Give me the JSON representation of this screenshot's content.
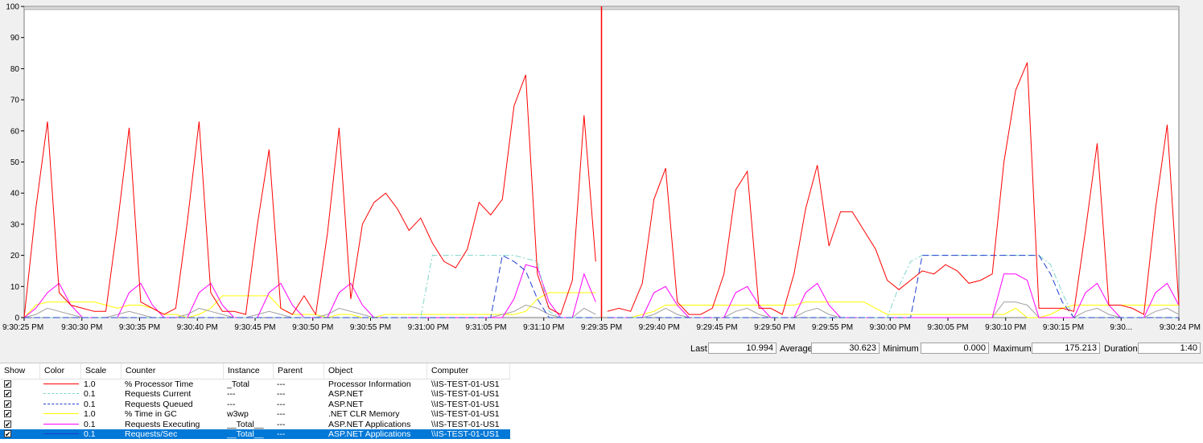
{
  "chart_data": {
    "type": "line",
    "ylim": [
      0,
      100
    ],
    "yticks": [
      0,
      10,
      20,
      30,
      40,
      50,
      60,
      70,
      80,
      90,
      100
    ],
    "xticks": [
      "9:30:25 PM",
      "9:30:30 PM",
      "9:30:35 PM",
      "9:30:40 PM",
      "9:30:45 PM",
      "9:30:50 PM",
      "9:30:55 PM",
      "9:31:00 PM",
      "9:31:05 PM",
      "9:31:10 PM",
      "9:29:35 PM",
      "9:29:40 PM",
      "9:29:45 PM",
      "9:29:50 PM",
      "9:29:55 PM",
      "9:30:00 PM",
      "9:30:05 PM",
      "9:30:10 PM",
      "9:30:15 PM",
      "9:30...",
      "9:30:24 PM"
    ],
    "samples": 100,
    "current_index": 49,
    "series": [
      {
        "name": "% Processor Time",
        "color": "#ff0000",
        "dash": "solid",
        "values": [
          0,
          35,
          63,
          8,
          4,
          3,
          2,
          2,
          30,
          61,
          5,
          3,
          1,
          3,
          31,
          63,
          8,
          2,
          2,
          1,
          30,
          54,
          3,
          1,
          7,
          1,
          27,
          61,
          6,
          30,
          37,
          40,
          35,
          28,
          32,
          24,
          18,
          16,
          22,
          37,
          33,
          38,
          68,
          78,
          14,
          3,
          1,
          12,
          65,
          18,
          2,
          3,
          2,
          11,
          38,
          48,
          5,
          1,
          1,
          3,
          14,
          41,
          47,
          3,
          3,
          1,
          14,
          35,
          49,
          23,
          34,
          34,
          28,
          22,
          12,
          9,
          12,
          15,
          14,
          17,
          15,
          11,
          12,
          14,
          50,
          73,
          82,
          3,
          3,
          3,
          2,
          28,
          56,
          4,
          4,
          3,
          1,
          35,
          62,
          4,
          1,
          1
        ]
      },
      {
        "name": "Requests Current",
        "color": "#7fd6c8",
        "dash": "dash-dot",
        "values": [
          0,
          0,
          0,
          0,
          0,
          0,
          0,
          0,
          0,
          0,
          0,
          0,
          0,
          0,
          0,
          0,
          0,
          0,
          0,
          0,
          0,
          0,
          0,
          0,
          0,
          0,
          0,
          0,
          0,
          0,
          0,
          0,
          0,
          0,
          0,
          20,
          20,
          20,
          20,
          20,
          20,
          20,
          20,
          19,
          18,
          2,
          0,
          0,
          0,
          0,
          0,
          0,
          0,
          0,
          0,
          0,
          0,
          0,
          0,
          0,
          0,
          0,
          0,
          0,
          0,
          0,
          0,
          0,
          0,
          0,
          0,
          0,
          0,
          0,
          0,
          10,
          18,
          20,
          20,
          20,
          20,
          20,
          20,
          20,
          20,
          20,
          20,
          20,
          17,
          8,
          0,
          0,
          0,
          0,
          0,
          0,
          0,
          0,
          0,
          0,
          0,
          0
        ]
      },
      {
        "name": "Requests Queued",
        "color": "#1f3fd0",
        "dash": "dashed",
        "values": [
          0,
          0,
          0,
          0,
          0,
          0,
          0,
          0,
          0,
          0,
          0,
          0,
          0,
          0,
          0,
          0,
          0,
          0,
          0,
          0,
          0,
          0,
          0,
          0,
          0,
          0,
          0,
          0,
          0,
          0,
          0,
          0,
          0,
          0,
          0,
          0,
          0,
          0,
          0,
          0,
          0,
          20,
          18,
          15,
          6,
          0,
          0,
          0,
          0,
          0,
          0,
          0,
          0,
          0,
          0,
          0,
          0,
          0,
          0,
          0,
          0,
          0,
          0,
          0,
          0,
          0,
          0,
          0,
          0,
          0,
          0,
          0,
          0,
          0,
          0,
          0,
          0,
          20,
          20,
          20,
          20,
          20,
          20,
          20,
          20,
          20,
          20,
          20,
          14,
          5,
          0,
          0,
          0,
          0,
          0,
          0,
          0,
          0,
          0,
          0,
          0,
          0
        ]
      },
      {
        "name": "% Time in GC",
        "color": "#ffff00",
        "dash": "solid",
        "values": [
          0,
          4,
          5,
          5,
          5,
          5,
          5,
          4,
          3,
          4,
          4,
          3,
          1,
          1,
          0,
          1,
          3,
          7,
          7,
          7,
          7,
          7,
          3,
          1,
          1,
          1,
          0,
          1,
          1,
          0,
          0,
          1,
          1,
          1,
          1,
          1,
          1,
          1,
          1,
          1,
          1,
          1,
          1,
          2,
          6,
          8,
          8,
          8,
          8,
          8,
          0,
          0,
          0,
          1,
          2,
          4,
          4,
          4,
          4,
          4,
          4,
          4,
          4,
          4,
          4,
          4,
          4,
          5,
          5,
          5,
          5,
          5,
          5,
          3,
          1,
          1,
          1,
          1,
          1,
          1,
          1,
          1,
          1,
          1,
          1,
          3,
          0,
          0,
          1,
          3,
          4,
          4,
          4,
          4,
          4,
          4,
          4,
          4,
          4,
          4,
          3,
          2
        ]
      },
      {
        "name": "Requests Executing",
        "color": "#ff00ff",
        "dash": "solid",
        "values": [
          0,
          3,
          8,
          11,
          4,
          0,
          0,
          0,
          0,
          8,
          11,
          4,
          0,
          0,
          0,
          8,
          11,
          4,
          0,
          0,
          0,
          8,
          11,
          4,
          0,
          0,
          0,
          8,
          11,
          4,
          0,
          0,
          0,
          0,
          0,
          0,
          0,
          0,
          0,
          0,
          0,
          0,
          6,
          17,
          16,
          5,
          0,
          0,
          14,
          5,
          0,
          0,
          0,
          0,
          8,
          10,
          4,
          0,
          0,
          0,
          0,
          8,
          10,
          4,
          0,
          0,
          0,
          8,
          11,
          4,
          0,
          0,
          0,
          0,
          0,
          0,
          0,
          0,
          0,
          0,
          0,
          0,
          0,
          0,
          14,
          14,
          12,
          0,
          0,
          0,
          0,
          8,
          11,
          4,
          0,
          0,
          0,
          8,
          11,
          4,
          0,
          0
        ]
      },
      {
        "name": "Requests/Sec",
        "color": "#a0a0a0",
        "dash": "solid",
        "values": [
          0,
          1,
          3,
          2,
          1,
          0,
          0,
          0,
          1,
          2,
          1,
          0,
          0,
          0,
          1,
          3,
          2,
          1,
          0,
          0,
          1,
          2,
          1,
          0,
          0,
          0,
          1,
          3,
          2,
          1,
          0,
          0,
          0,
          0,
          0,
          0,
          0,
          0,
          0,
          0,
          0,
          1,
          2,
          4,
          3,
          1,
          0,
          0,
          3,
          1,
          0,
          0,
          0,
          0,
          1,
          3,
          1,
          0,
          0,
          0,
          0,
          2,
          3,
          1,
          0,
          0,
          0,
          2,
          3,
          1,
          0,
          0,
          0,
          0,
          0,
          0,
          0,
          0,
          0,
          0,
          0,
          0,
          0,
          0,
          5,
          5,
          4,
          0,
          0,
          0,
          0,
          2,
          3,
          1,
          0,
          0,
          0,
          2,
          3,
          1,
          0,
          0
        ]
      }
    ]
  },
  "stats": {
    "last_label": "Last",
    "last_value": "10.994",
    "average_label": "Average",
    "average_value": "30.623",
    "minimum_label": "Minimum",
    "minimum_value": "0.000",
    "maximum_label": "Maximum",
    "maximum_value": "175.213",
    "duration_label": "Duration",
    "duration_value": "1:40"
  },
  "table": {
    "headers": {
      "show": "Show",
      "color": "Color",
      "scale": "Scale",
      "counter": "Counter",
      "instance": "Instance",
      "parent": "Parent",
      "object": "Object",
      "computer": "Computer"
    },
    "rows": [
      {
        "checked": "✔",
        "color": "#ff0000",
        "dash": "solid",
        "scale": "1.0",
        "counter": "% Processor Time",
        "instance": "_Total",
        "parent": "---",
        "object": "Processor Information",
        "computer": "\\\\IS-TEST-01-US1"
      },
      {
        "checked": "✔",
        "color": "#7fd6c8",
        "dash": "dashed",
        "scale": "0.1",
        "counter": "Requests Current",
        "instance": "---",
        "parent": "---",
        "object": "ASP.NET",
        "computer": "\\\\IS-TEST-01-US1"
      },
      {
        "checked": "✔",
        "color": "#1f3fd0",
        "dash": "dashed",
        "scale": "0.1",
        "counter": "Requests Queued",
        "instance": "---",
        "parent": "---",
        "object": "ASP.NET",
        "computer": "\\\\IS-TEST-01-US1"
      },
      {
        "checked": "✔",
        "color": "#ffff00",
        "dash": "solid",
        "scale": "1.0",
        "counter": "% Time in GC",
        "instance": "w3wp",
        "parent": "---",
        "object": ".NET CLR Memory",
        "computer": "\\\\IS-TEST-01-US1"
      },
      {
        "checked": "✔",
        "color": "#ff00ff",
        "dash": "solid",
        "scale": "0.1",
        "counter": "Requests Executing",
        "instance": "__Total__",
        "parent": "---",
        "object": "ASP.NET Applications",
        "computer": "\\\\IS-TEST-01-US1"
      },
      {
        "checked": "✔",
        "color": "#1f3fd0",
        "dash": "solid",
        "scale": "0.1",
        "counter": "Requests/Sec",
        "instance": "__Total__",
        "parent": "---",
        "object": "ASP.NET Applications",
        "computer": "\\\\IS-TEST-01-US1"
      }
    ]
  }
}
